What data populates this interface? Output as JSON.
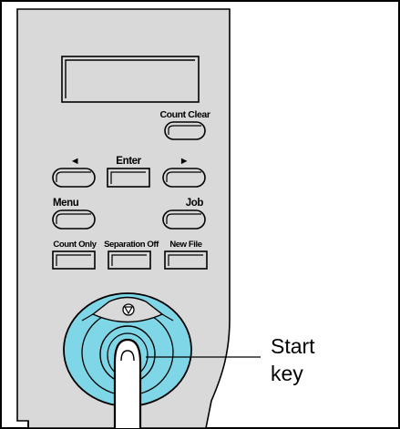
{
  "panel": {
    "colors": {
      "panel_face": "#d9d9d9",
      "background": "#ffffff",
      "start_ring": "#7fd6e6",
      "outline": "#000000"
    },
    "buttons": {
      "count_clear": "Count Clear",
      "enter": "Enter",
      "left_arrow": "◄",
      "right_arrow": "►",
      "menu": "Menu",
      "job": "Job",
      "count_only": "Count Only",
      "separation_off": "Separation Off",
      "new_file": "New File"
    },
    "icons": {
      "stop": "stop-icon",
      "finger": "finger-icon"
    }
  },
  "callout": {
    "line1": "Start",
    "line2": "key"
  }
}
